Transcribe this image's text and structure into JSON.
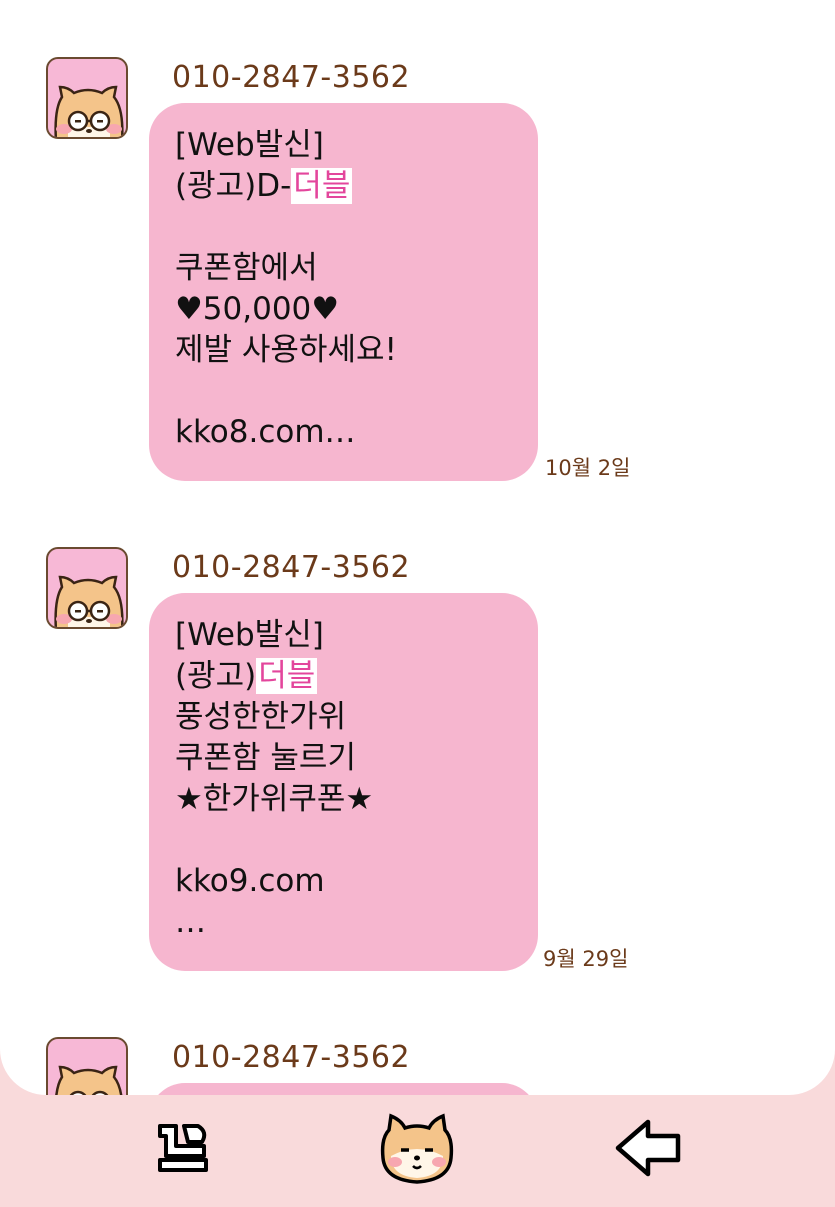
{
  "colors": {
    "chat_bg": "#ffffff",
    "nav_bg": "#f9dadb",
    "bubble": "#f6b6cf",
    "highlight_text": "#e3469c",
    "sender_text": "#6b3a1a",
    "avatar_bg": "#f7b8d6"
  },
  "messages": [
    {
      "sender": "010-2847-3562",
      "avatar_icon": "shiba-glasses-avatar-icon",
      "lines": [
        {
          "pre": "[Web발신]",
          "hl": ""
        },
        {
          "pre": "(광고)D-",
          "hl": "더블"
        },
        {
          "pre": "",
          "hl": ""
        },
        {
          "pre": "쿠폰함에서",
          "hl": ""
        },
        {
          "pre": "♥50,000♥",
          "hl": ""
        },
        {
          "pre": "제발 사용하세요!",
          "hl": ""
        },
        {
          "pre": "",
          "hl": ""
        },
        {
          "pre": "kko8.com…",
          "hl": ""
        }
      ],
      "time": "10월 2일"
    },
    {
      "sender": "010-2847-3562",
      "avatar_icon": "shiba-glasses-avatar-icon",
      "lines": [
        {
          "pre": "[Web발신]",
          "hl": ""
        },
        {
          "pre": "(광고)",
          "hl": "더블"
        },
        {
          "pre": "풍성한한가위",
          "hl": ""
        },
        {
          "pre": "쿠폰함 눌르기",
          "hl": ""
        },
        {
          "pre": "★한가위쿠폰★",
          "hl": ""
        },
        {
          "pre": "",
          "hl": ""
        },
        {
          "pre": "kko9.com",
          "hl": ""
        },
        {
          "pre": "…",
          "hl": ""
        }
      ],
      "time": "9월 29일"
    },
    {
      "sender": "010-2847-3562",
      "avatar_icon": "shiba-glasses-avatar-icon",
      "lines": [],
      "time": ""
    }
  ],
  "nav": {
    "recent_icon": "recent-apps-icon",
    "home_icon": "shiba-home-icon",
    "back_icon": "back-arrow-icon"
  }
}
